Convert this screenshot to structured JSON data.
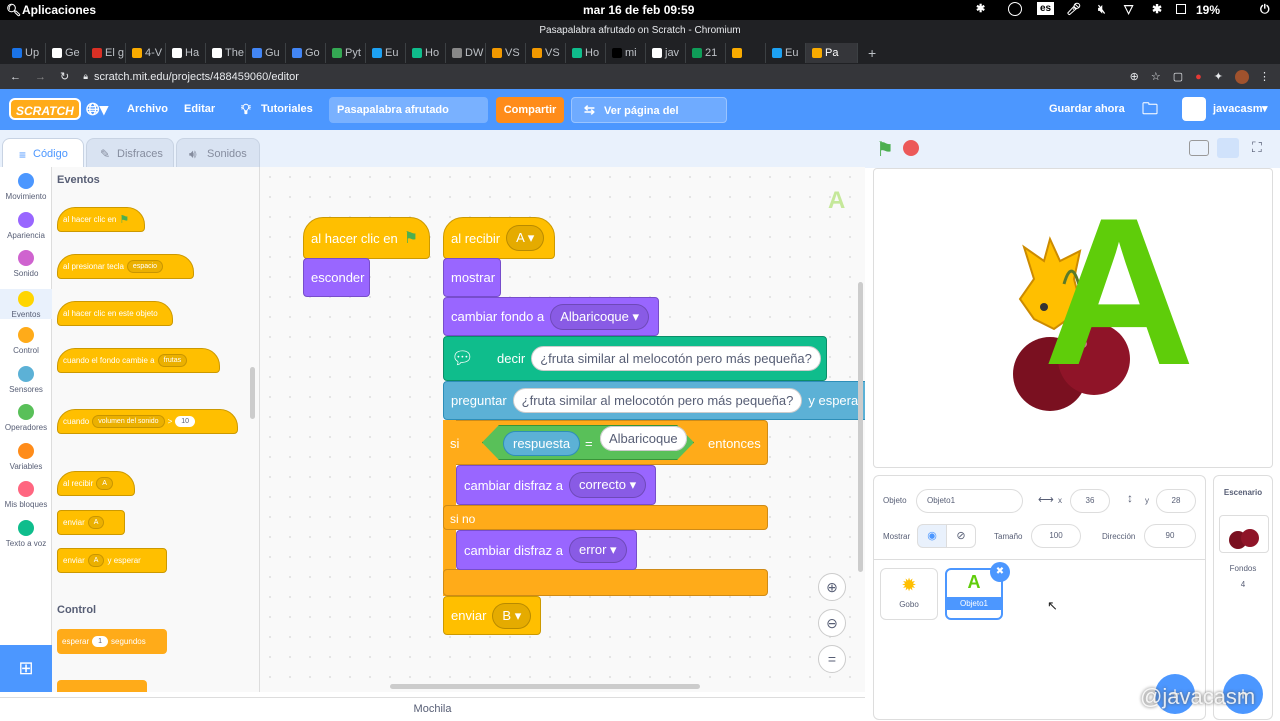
{
  "os": {
    "apps": "Aplicaciones",
    "datetime": "mar 16 de feb  09:59",
    "lang": "es",
    "battery": "19%"
  },
  "window_title": "Pasapalabra afrutado on Scratch - Chromium",
  "tabs": [
    "Up",
    "Ge",
    "El g",
    "4-V",
    "Ha",
    "The",
    "Gu",
    "Go",
    "Pyt",
    "Eu",
    "Ho",
    "DW",
    "VS",
    "VS",
    "Ho",
    "mi",
    "jav",
    "21",
    "",
    "Eu",
    "Pa"
  ],
  "tab_colors": [
    "#1a73e8",
    "#fff",
    "#d93025",
    "#f9ab00",
    "#fff",
    "#fff",
    "#4285f4",
    "#4285f4",
    "#34a853",
    "#1da1f2",
    "#0fbd8c",
    "#888",
    "#f29900",
    "#f29900",
    "#0fbd8c",
    "#000",
    "#fff",
    "#0f9d58",
    "#f9ab00",
    "#1da1f2",
    "#f9ab00"
  ],
  "url": "scratch.mit.edu/projects/488459060/editor",
  "menu": {
    "archivo": "Archivo",
    "editar": "Editar",
    "tutoriales": "Tutoriales",
    "project_title": "Pasapalabra afrutado",
    "compartir": "Compartir",
    "ver_pagina": "Ver página del proyecto",
    "guardar": "Guardar ahora",
    "user": "javacasm",
    "logo": "SCRATCH"
  },
  "editor_tabs": {
    "codigo": "Código",
    "disfraces": "Disfraces",
    "sonidos": "Sonidos"
  },
  "categories": [
    {
      "label": "Movimiento",
      "color": "#4c97ff"
    },
    {
      "label": "Apariencia",
      "color": "#9966ff"
    },
    {
      "label": "Sonido",
      "color": "#cf63cf"
    },
    {
      "label": "Eventos",
      "color": "#ffd500"
    },
    {
      "label": "Control",
      "color": "#ffab19"
    },
    {
      "label": "Sensores",
      "color": "#5cb1d6"
    },
    {
      "label": "Operadores",
      "color": "#59c059"
    },
    {
      "label": "Variables",
      "color": "#ff8c1a"
    },
    {
      "label": "Mis bloques",
      "color": "#ff6680"
    },
    {
      "label": "Texto a voz",
      "color": "#0fbd8c"
    }
  ],
  "palette": {
    "eventos_title": "Eventos",
    "al_hacer_clic_en": "al hacer clic en",
    "al_presionar_tecla": "al presionar tecla",
    "espacio": "espacio",
    "al_hacer_clic_objeto": "al hacer clic en este objeto",
    "cuando_fondo": "cuando el fondo cambie a",
    "frutas": "frutas",
    "cuando": "cuando",
    "volumen": "volumen del sonido",
    "gt": ">",
    "ten": "10",
    "al_recibir": "al recibir",
    "A": "A",
    "enviar": "enviar",
    "y_esperar": "y esperar",
    "control_title": "Control",
    "esperar": "esperar",
    "uno": "1",
    "segundos": "segundos"
  },
  "script": {
    "hat1": "al hacer clic en",
    "esconder": "esconder",
    "al_recibir": "al recibir",
    "msg_A": "A",
    "mostrar": "mostrar",
    "cambiar_fondo": "cambiar fondo a",
    "fondo_val": "Albaricoque",
    "decir": "decir",
    "pregunta": "¿fruta similar al melocotón pero más pequeña?",
    "preguntar": "preguntar",
    "y_espera": "y espera",
    "si": "si",
    "respuesta": "respuesta",
    "eq": "=",
    "respuesta_val": "Albaricoque",
    "entonces": "entonces",
    "cambiar_disfraz": "cambiar disfraz a",
    "correcto": "correcto",
    "si_no": "si no",
    "error": "error",
    "enviar": "enviar",
    "msg_B": "B",
    "corner_letter": "A"
  },
  "mochila": "Mochila",
  "sprite_info": {
    "objeto_label": "Objeto",
    "objeto_name": "Objeto1",
    "x_label": "x",
    "x": "36",
    "y_label": "y",
    "y": "28",
    "mostrar_label": "Mostrar",
    "tamano_label": "Tamaño",
    "tamano": "100",
    "direccion_label": "Dirección",
    "direccion": "90"
  },
  "sprites": [
    {
      "name": "Gobo"
    },
    {
      "name": "Objeto1",
      "letter": "A"
    }
  ],
  "stage_panel": {
    "title": "Escenario",
    "fondos_label": "Fondos",
    "fondos_count": "4"
  },
  "stage_letter": "A",
  "watermark": "@javacasm"
}
